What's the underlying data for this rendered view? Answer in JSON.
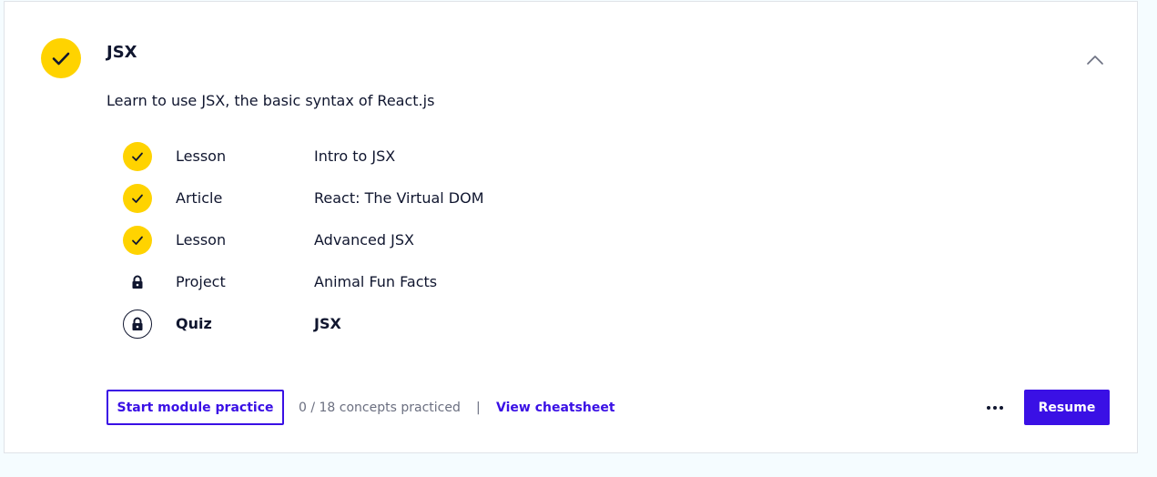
{
  "module": {
    "title": "JSX",
    "description": "Learn to use JSX, the basic syntax of React.js",
    "status_icon": "check-icon",
    "accent_color": "#ffd300",
    "collapse_icon": "chevron-up-icon"
  },
  "items": [
    {
      "type": "Lesson",
      "name": "Intro to JSX",
      "status": "completed",
      "icon": "check-icon"
    },
    {
      "type": "Article",
      "name": "React: The Virtual DOM",
      "status": "completed",
      "icon": "check-icon"
    },
    {
      "type": "Lesson",
      "name": "Advanced JSX",
      "status": "completed",
      "icon": "check-icon"
    },
    {
      "type": "Project",
      "name": "Animal Fun Facts",
      "status": "locked",
      "icon": "lock-icon"
    },
    {
      "type": "Quiz",
      "name": "JSX",
      "status": "locked",
      "icon": "lock-icon"
    }
  ],
  "footer": {
    "practice_label": "Start module practice",
    "concepts_text": "0 / 18 concepts practiced",
    "separator": "|",
    "cheatsheet_label": "View cheatsheet",
    "more_icon": "more-horizontal-icon",
    "resume_label": "Resume"
  },
  "colors": {
    "primary": "#3a10e5",
    "text": "#10162f",
    "muted": "#6b6f80",
    "background": "#f5fcff"
  }
}
